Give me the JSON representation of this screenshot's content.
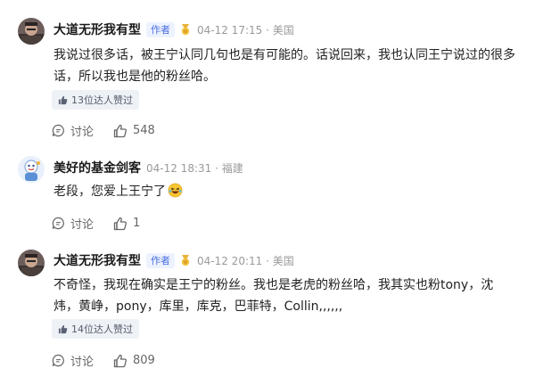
{
  "comments": [
    {
      "user": "大道无形我有型",
      "author_tag": "作者",
      "time": "04-12 17:15 · 美国",
      "text": "我说过很多话，被王宁认同几句也是有可能的。话说回来，我也认同王宁说过的很多话，所以我也是他的粉丝哈。",
      "expert_likes": "13位达人赞过",
      "discuss_label": "讨论",
      "like_count": "548"
    },
    {
      "user": "美好的基金剑客",
      "time": "04-12 18:31 · 福建",
      "text": "老段，您爱上王宁了",
      "discuss_label": "讨论",
      "like_count": "1"
    },
    {
      "user": "大道无形我有型",
      "author_tag": "作者",
      "time": "04-12 20:11 · 美国",
      "text": "不奇怪，我现在确实是王宁的粉丝。我也是老虎的粉丝哈，我其实也粉tony，沈炜，黄峥，pony，库里，库克，巴菲特，Collin,,,,,,",
      "expert_likes": "14位达人赞过",
      "discuss_label": "讨论",
      "like_count": "809"
    }
  ],
  "icons": {
    "discuss": "speech-bubble-icon",
    "like": "thumbs-up-icon",
    "medal": "gold-medal-icon",
    "emoji": "laughing-emoji-icon"
  },
  "colors": {
    "author_tag_text": "#4a6ee0",
    "author_tag_bg": "#edf2ff",
    "chip_bg": "#eef1f6",
    "meta_text": "#9a9a9a"
  }
}
